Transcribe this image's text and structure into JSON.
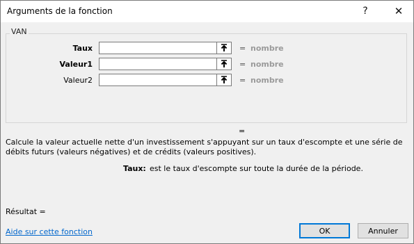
{
  "window": {
    "title": "Arguments de la fonction",
    "help_glyph": "?",
    "close_glyph": "✕"
  },
  "function": {
    "name": "VAN",
    "args": [
      {
        "label": "Taux",
        "value": "",
        "result": "nombre",
        "bold": true
      },
      {
        "label": "Valeur1",
        "value": "",
        "result": "nombre",
        "bold": true
      },
      {
        "label": "Valeur2",
        "value": "",
        "result": "nombre",
        "bold": false
      }
    ],
    "equals": "=",
    "description": "Calcule la valeur actuelle nette d'un investissement s'appuyant sur un taux d'escompte et une série de débits futurs (valeurs négatives) et de crédits (valeurs positives).",
    "arg_help_name": "Taux:",
    "arg_help_text": "est le taux d'escompte sur toute la durée de la période."
  },
  "footer": {
    "result_label": "Résultat =",
    "help_link": "Aide sur cette fonction",
    "ok_label": "OK",
    "cancel_label": "Annuler"
  },
  "icons": {
    "collapse": "collapse-dialog-icon"
  }
}
